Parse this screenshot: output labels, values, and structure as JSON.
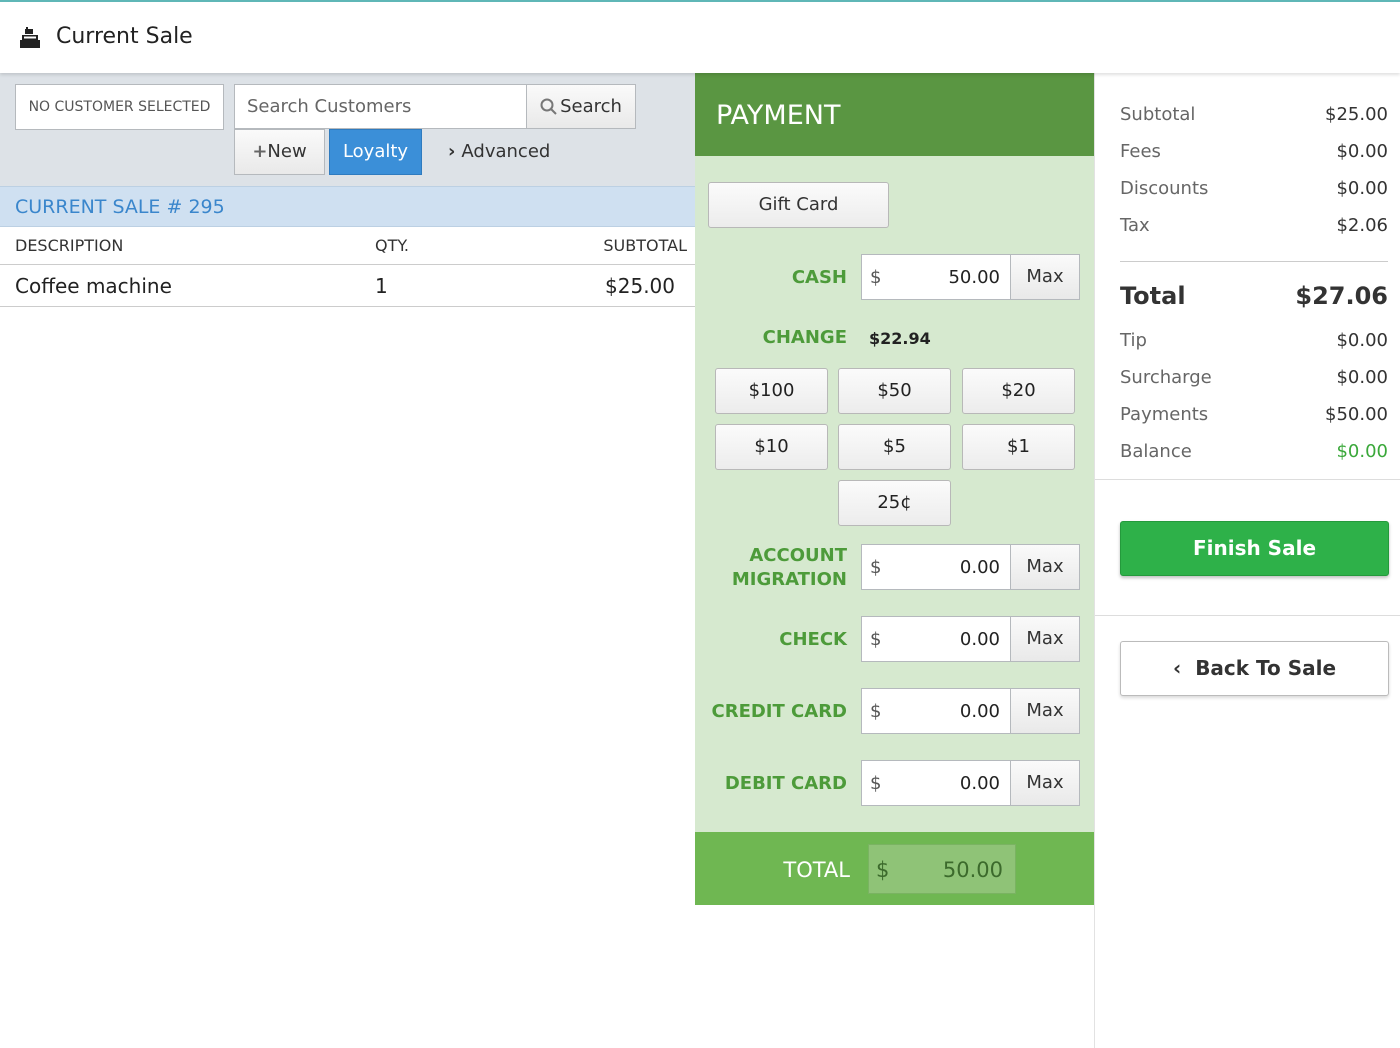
{
  "header": {
    "title": "Current Sale",
    "icon": "register-icon"
  },
  "customer": {
    "none_label": "NO CUSTOMER SELECTED",
    "search_placeholder": "Search Customers",
    "search_button": "Search",
    "new_button": "New",
    "loyalty_button": "Loyalty",
    "advanced_link": "Advanced"
  },
  "sale": {
    "title": "CURRENT SALE # 295",
    "columns": {
      "description": "DESCRIPTION",
      "qty": "QTY.",
      "subtotal": "SUBTOTAL"
    },
    "items": [
      {
        "description": "Coffee machine",
        "qty": "1",
        "subtotal": "$25.00"
      }
    ]
  },
  "payment": {
    "title": "PAYMENT",
    "gift_card": "Gift Card",
    "currency_symbol": "$",
    "max_label": "Max",
    "cash": {
      "label": "CASH",
      "value": "50.00"
    },
    "change": {
      "label": "CHANGE",
      "value": "$22.94"
    },
    "denominations": [
      "$100",
      "$50",
      "$20",
      "$10",
      "$5",
      "$1",
      "25¢"
    ],
    "account_migration": {
      "label_line1": "ACCOUNT",
      "label_line2": "MIGRATION",
      "value": "0.00"
    },
    "check": {
      "label": "CHECK",
      "value": "0.00"
    },
    "credit_card": {
      "label": "CREDIT CARD",
      "value": "0.00"
    },
    "debit_card": {
      "label": "DEBIT CARD",
      "value": "0.00"
    },
    "total": {
      "label": "TOTAL",
      "value": "50.00"
    }
  },
  "summary": {
    "subtotal": {
      "label": "Subtotal",
      "value": "$25.00"
    },
    "fees": {
      "label": "Fees",
      "value": "$0.00"
    },
    "discounts": {
      "label": "Discounts",
      "value": "$0.00"
    },
    "tax": {
      "label": "Tax",
      "value": "$2.06"
    },
    "total": {
      "label": "Total",
      "value": "$27.06"
    },
    "tip": {
      "label": "Tip",
      "value": "$0.00"
    },
    "surcharge": {
      "label": "Surcharge",
      "value": "$0.00"
    },
    "payments": {
      "label": "Payments",
      "value": "$50.00"
    },
    "balance": {
      "label": "Balance",
      "value": "$0.00"
    },
    "finish_button": "Finish Sale",
    "back_button": "Back To Sale"
  },
  "colors": {
    "accent_blue": "#3b8fd8",
    "payment_green": "#5a9642",
    "label_green": "#4d9b3a",
    "finish_green": "#2eb149",
    "balance_green": "#3aa83a"
  }
}
